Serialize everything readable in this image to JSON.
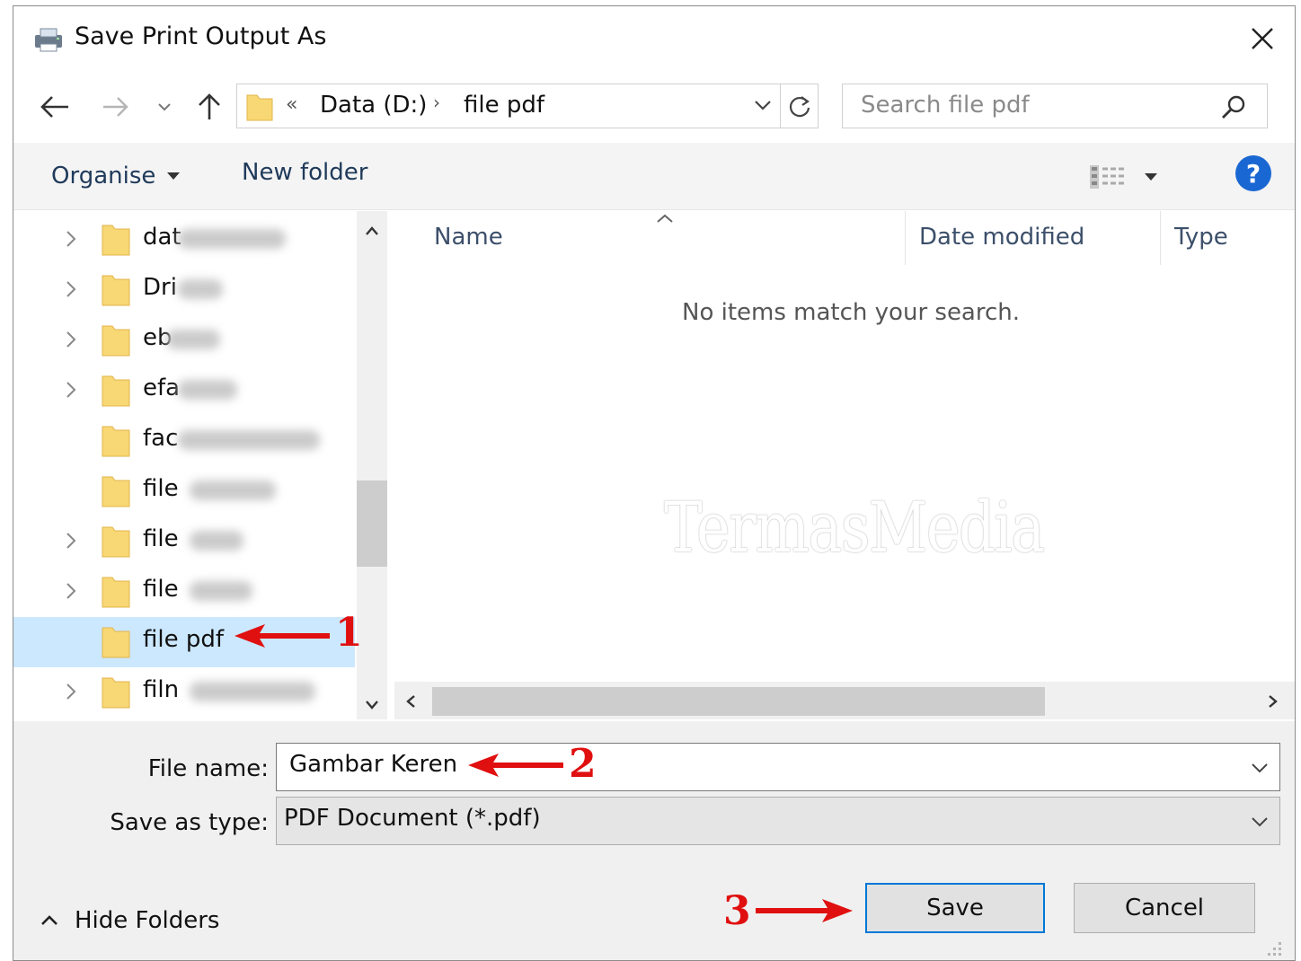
{
  "window": {
    "title": "Save Print Output As"
  },
  "address": {
    "overflow": "«",
    "segments": [
      "Data (D:)",
      "file pdf"
    ]
  },
  "search": {
    "placeholder": "Search file pdf"
  },
  "toolbar": {
    "organise": "Organise",
    "new_folder": "New folder",
    "help_glyph": "?"
  },
  "tree": {
    "items": [
      {
        "label": "dat",
        "expandable": true,
        "selected": false,
        "blur_width": 120
      },
      {
        "label": "Dri",
        "expandable": true,
        "selected": false,
        "blur_width": 50
      },
      {
        "label": "eb",
        "expandable": true,
        "selected": false,
        "blur_width": 60
      },
      {
        "label": "efa",
        "expandable": true,
        "selected": false,
        "blur_width": 66
      },
      {
        "label": "fac",
        "expandable": false,
        "selected": false,
        "blur_width": 158
      },
      {
        "label": "file",
        "expandable": false,
        "selected": false,
        "blur_width": 96
      },
      {
        "label": "file",
        "expandable": true,
        "selected": false,
        "blur_width": 60
      },
      {
        "label": "file",
        "expandable": true,
        "selected": false,
        "blur_width": 70
      },
      {
        "label": "file pdf",
        "expandable": false,
        "selected": true,
        "blur_width": 0
      },
      {
        "label": "filn",
        "expandable": true,
        "selected": false,
        "blur_width": 140
      }
    ]
  },
  "columns": {
    "name": "Name",
    "date_modified": "Date modified",
    "type": "Type"
  },
  "file_list": {
    "empty_message": "No items match your search."
  },
  "watermark": "TermasMedia",
  "form": {
    "file_name_label": "File name:",
    "file_name_value": "Gambar Keren",
    "save_type_label": "Save as type:",
    "save_type_value": "PDF Document (*.pdf)"
  },
  "footer": {
    "hide_folders": "Hide Folders",
    "save": "Save",
    "cancel": "Cancel"
  },
  "annotations": [
    "1",
    "2",
    "3"
  ],
  "colors": {
    "annotation": "#e01010",
    "selection": "#cce8ff",
    "primary_border": "#0078d7",
    "help": "#1967d2",
    "folder": "#f8d775"
  }
}
